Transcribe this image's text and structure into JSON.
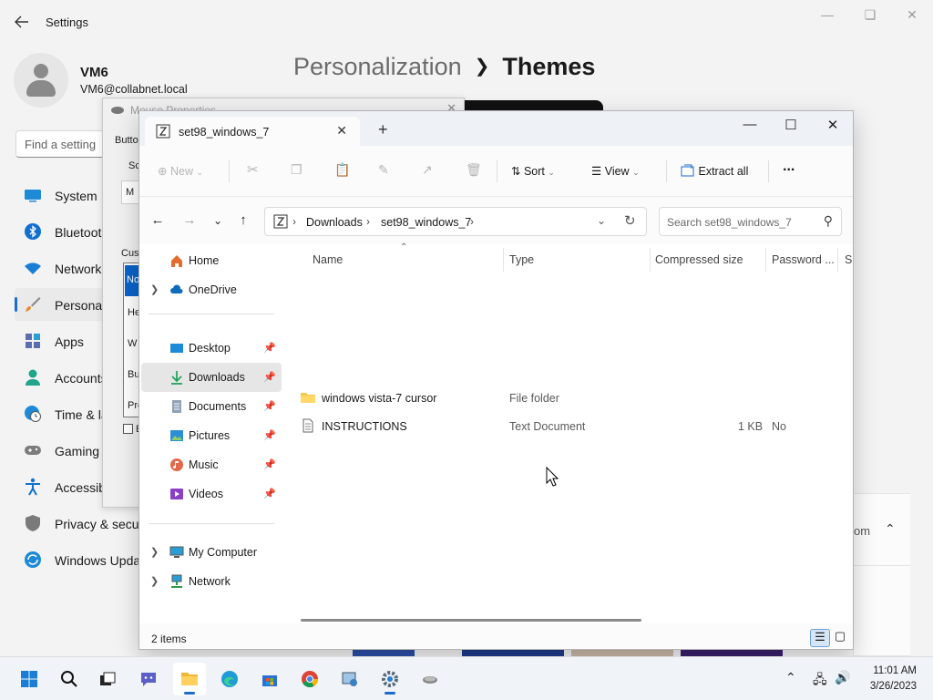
{
  "settings": {
    "title": "Settings",
    "user": {
      "name": "VM6",
      "email": "VM6@collabnet.local"
    },
    "search_placeholder": "Find a setting",
    "breadcrumb": {
      "parent": "Personalization",
      "current": "Themes"
    },
    "sidebar": [
      {
        "label": "System",
        "icon": "monitor-icon"
      },
      {
        "label": "Bluetooth & devices",
        "icon": "bluetooth-icon"
      },
      {
        "label": "Network & internet",
        "icon": "wifi-icon"
      },
      {
        "label": "Personalization",
        "icon": "brush-icon",
        "active": true
      },
      {
        "label": "Apps",
        "icon": "apps-icon"
      },
      {
        "label": "Accounts",
        "icon": "account-icon"
      },
      {
        "label": "Time & language",
        "icon": "clock-globe-icon"
      },
      {
        "label": "Gaming",
        "icon": "gamepad-icon"
      },
      {
        "label": "Accessibility",
        "icon": "accessibility-icon"
      },
      {
        "label": "Privacy & security",
        "icon": "shield-icon"
      },
      {
        "label": "Windows Update",
        "icon": "update-icon"
      }
    ],
    "card_text": "om"
  },
  "mouse_properties": {
    "title": "Mouse Properties",
    "tab": "Butto",
    "labels": [
      "Sc",
      "M",
      "Cust",
      "No",
      "He",
      "W",
      "Bu",
      "Pre",
      "E"
    ]
  },
  "explorer": {
    "tab_title": "set98_windows_7",
    "toolbar": {
      "new": "New",
      "sort": "Sort",
      "view": "View",
      "extract_all": "Extract all",
      "more": "..."
    },
    "address": {
      "crumbs": [
        "Downloads",
        "set98_windows_7"
      ],
      "search_placeholder": "Search set98_windows_7"
    },
    "nav": {
      "home": "Home",
      "onedrive": "OneDrive",
      "quick_access": [
        "Desktop",
        "Downloads",
        "Documents",
        "Pictures",
        "Music",
        "Videos"
      ],
      "my_computer": "My Computer",
      "network": "Network"
    },
    "columns": [
      "Name",
      "Type",
      "Compressed size",
      "Password ...",
      "Si"
    ],
    "files": [
      {
        "name": "windows vista-7 cursor",
        "type": "File folder",
        "size": "",
        "password": "",
        "icon": "folder-icon"
      },
      {
        "name": "INSTRUCTIONS",
        "type": "Text Document",
        "size": "1 KB",
        "password": "No",
        "icon": "text-file-icon"
      }
    ],
    "status": "2 items"
  },
  "taskbar": {
    "time": "11:01 AM",
    "date": "3/26/2023",
    "apps": [
      "start",
      "search",
      "task-view",
      "teams-chat",
      "file-explorer",
      "edge",
      "store",
      "chrome",
      "control-panel",
      "settings",
      "mouse"
    ]
  }
}
